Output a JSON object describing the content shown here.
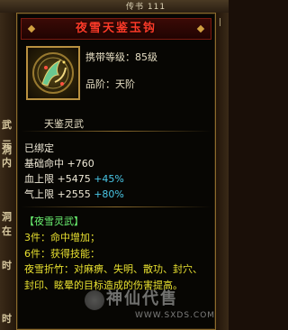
{
  "background": {
    "top_text": "传书  111",
    "left_chars": [
      "武",
      "元",
      "洞",
      "内",
      "洞",
      "在",
      "时",
      "时"
    ],
    "right_mark": "|"
  },
  "item": {
    "name": "夜雪天鉴玉钩",
    "level_req": "携带等级：85级",
    "grade": "品阶：天阶",
    "category": "天鉴灵武",
    "bound": "已绑定",
    "stats": [
      {
        "label": "基础命中",
        "value": "+760",
        "bonus": ""
      },
      {
        "label": "血上限",
        "value": "+5475",
        "bonus": "+45%"
      },
      {
        "label": "气上限",
        "value": "+2555",
        "bonus": "+80%"
      }
    ],
    "set_name": "【夜雪灵武】",
    "set_bonuses": [
      "3件：命中增加；",
      "6件：获得技能："
    ],
    "skill_desc": "夜雪折竹：对麻痹、失明、散功、封穴、封印、眩晕的目标造成的伤害提高。"
  },
  "watermark": {
    "text": "神仙代售",
    "url": "WWW.SXDS.COM"
  },
  "colors": {
    "title": "#ff3a28",
    "bonus": "#4ac8e8",
    "set": "#6af070",
    "set_effect": "#e8e030",
    "frame": "#8a6a2c"
  },
  "icons": {
    "item_icon": "jade-hook-weapon-icon"
  }
}
